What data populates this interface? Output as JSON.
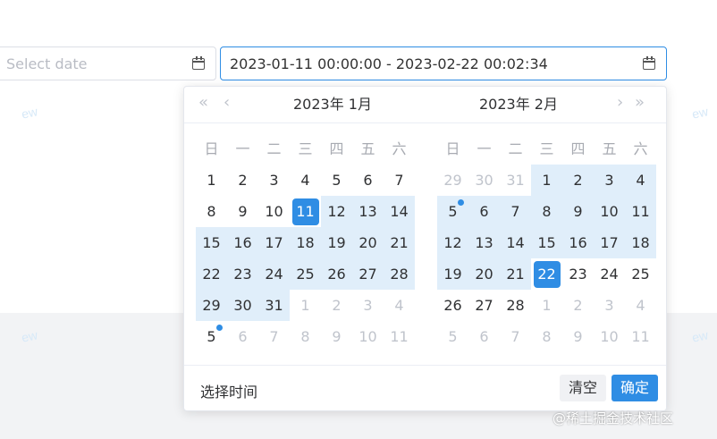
{
  "start_input": {
    "placeholder": "Select date"
  },
  "range_input": {
    "value": "2023-01-11 00:00:00 - 2023-02-22 00:02:34"
  },
  "picker": {
    "nav": {
      "prev_year": "«",
      "prev_month": "‹",
      "next_month": "›",
      "next_year": "»"
    },
    "left_title": "2023年 1月",
    "right_title": "2023年 2月",
    "weekdays": [
      "日",
      "一",
      "二",
      "三",
      "四",
      "五",
      "六"
    ],
    "select_time_label": "选择时间",
    "clear_label": "清空",
    "confirm_label": "确定"
  },
  "left_calendar": [
    [
      {
        "d": "1"
      },
      {
        "d": "2"
      },
      {
        "d": "3"
      },
      {
        "d": "4"
      },
      {
        "d": "5"
      },
      {
        "d": "6"
      },
      {
        "d": "7"
      }
    ],
    [
      {
        "d": "8"
      },
      {
        "d": "9"
      },
      {
        "d": "10"
      },
      {
        "d": "11",
        "sel": true
      },
      {
        "d": "12",
        "r": true
      },
      {
        "d": "13",
        "r": true
      },
      {
        "d": "14",
        "r": true
      }
    ],
    [
      {
        "d": "15",
        "r": true
      },
      {
        "d": "16",
        "r": true
      },
      {
        "d": "17",
        "r": true
      },
      {
        "d": "18",
        "r": true
      },
      {
        "d": "19",
        "r": true
      },
      {
        "d": "20",
        "r": true
      },
      {
        "d": "21",
        "r": true
      }
    ],
    [
      {
        "d": "22",
        "r": true
      },
      {
        "d": "23",
        "r": true
      },
      {
        "d": "24",
        "r": true
      },
      {
        "d": "25",
        "r": true
      },
      {
        "d": "26",
        "r": true
      },
      {
        "d": "27",
        "r": true
      },
      {
        "d": "28",
        "r": true
      }
    ],
    [
      {
        "d": "29",
        "r": true
      },
      {
        "d": "30",
        "r": true
      },
      {
        "d": "31",
        "r": true
      },
      {
        "d": "1",
        "o": true
      },
      {
        "d": "2",
        "o": true
      },
      {
        "d": "3",
        "o": true
      },
      {
        "d": "4",
        "o": true
      }
    ],
    [
      {
        "d": "5",
        "dot": true
      },
      {
        "d": "6",
        "o": true
      },
      {
        "d": "7",
        "o": true
      },
      {
        "d": "8",
        "o": true
      },
      {
        "d": "9",
        "o": true
      },
      {
        "d": "10",
        "o": true
      },
      {
        "d": "11",
        "o": true
      }
    ]
  ],
  "right_calendar": [
    [
      {
        "d": "29",
        "o": true
      },
      {
        "d": "30",
        "o": true
      },
      {
        "d": "31",
        "o": true
      },
      {
        "d": "1",
        "r": true
      },
      {
        "d": "2",
        "r": true
      },
      {
        "d": "3",
        "r": true
      },
      {
        "d": "4",
        "r": true
      }
    ],
    [
      {
        "d": "5",
        "r": true,
        "dot": true
      },
      {
        "d": "6",
        "r": true
      },
      {
        "d": "7",
        "r": true
      },
      {
        "d": "8",
        "r": true
      },
      {
        "d": "9",
        "r": true
      },
      {
        "d": "10",
        "r": true
      },
      {
        "d": "11",
        "r": true
      }
    ],
    [
      {
        "d": "12",
        "r": true
      },
      {
        "d": "13",
        "r": true
      },
      {
        "d": "14",
        "r": true
      },
      {
        "d": "15",
        "r": true
      },
      {
        "d": "16",
        "r": true
      },
      {
        "d": "17",
        "r": true
      },
      {
        "d": "18",
        "r": true
      }
    ],
    [
      {
        "d": "19",
        "r": true
      },
      {
        "d": "20",
        "r": true
      },
      {
        "d": "21",
        "r": true
      },
      {
        "d": "22",
        "sel": true
      },
      {
        "d": "23"
      },
      {
        "d": "24"
      },
      {
        "d": "25"
      }
    ],
    [
      {
        "d": "26"
      },
      {
        "d": "27"
      },
      {
        "d": "28"
      },
      {
        "d": "1",
        "o": true
      },
      {
        "d": "2",
        "o": true
      },
      {
        "d": "3",
        "o": true
      },
      {
        "d": "4",
        "o": true
      }
    ],
    [
      {
        "d": "5",
        "o": true
      },
      {
        "d": "6",
        "o": true
      },
      {
        "d": "7",
        "o": true
      },
      {
        "d": "8",
        "o": true
      },
      {
        "d": "9",
        "o": true
      },
      {
        "d": "10",
        "o": true
      },
      {
        "d": "11",
        "o": true
      }
    ]
  ],
  "watermark": "ew",
  "credit": "@稀土掘金技术社区",
  "colors": {
    "accent": "#2f8de4",
    "range_bg": "#e0eefa",
    "muted": "#c0c4cc"
  }
}
